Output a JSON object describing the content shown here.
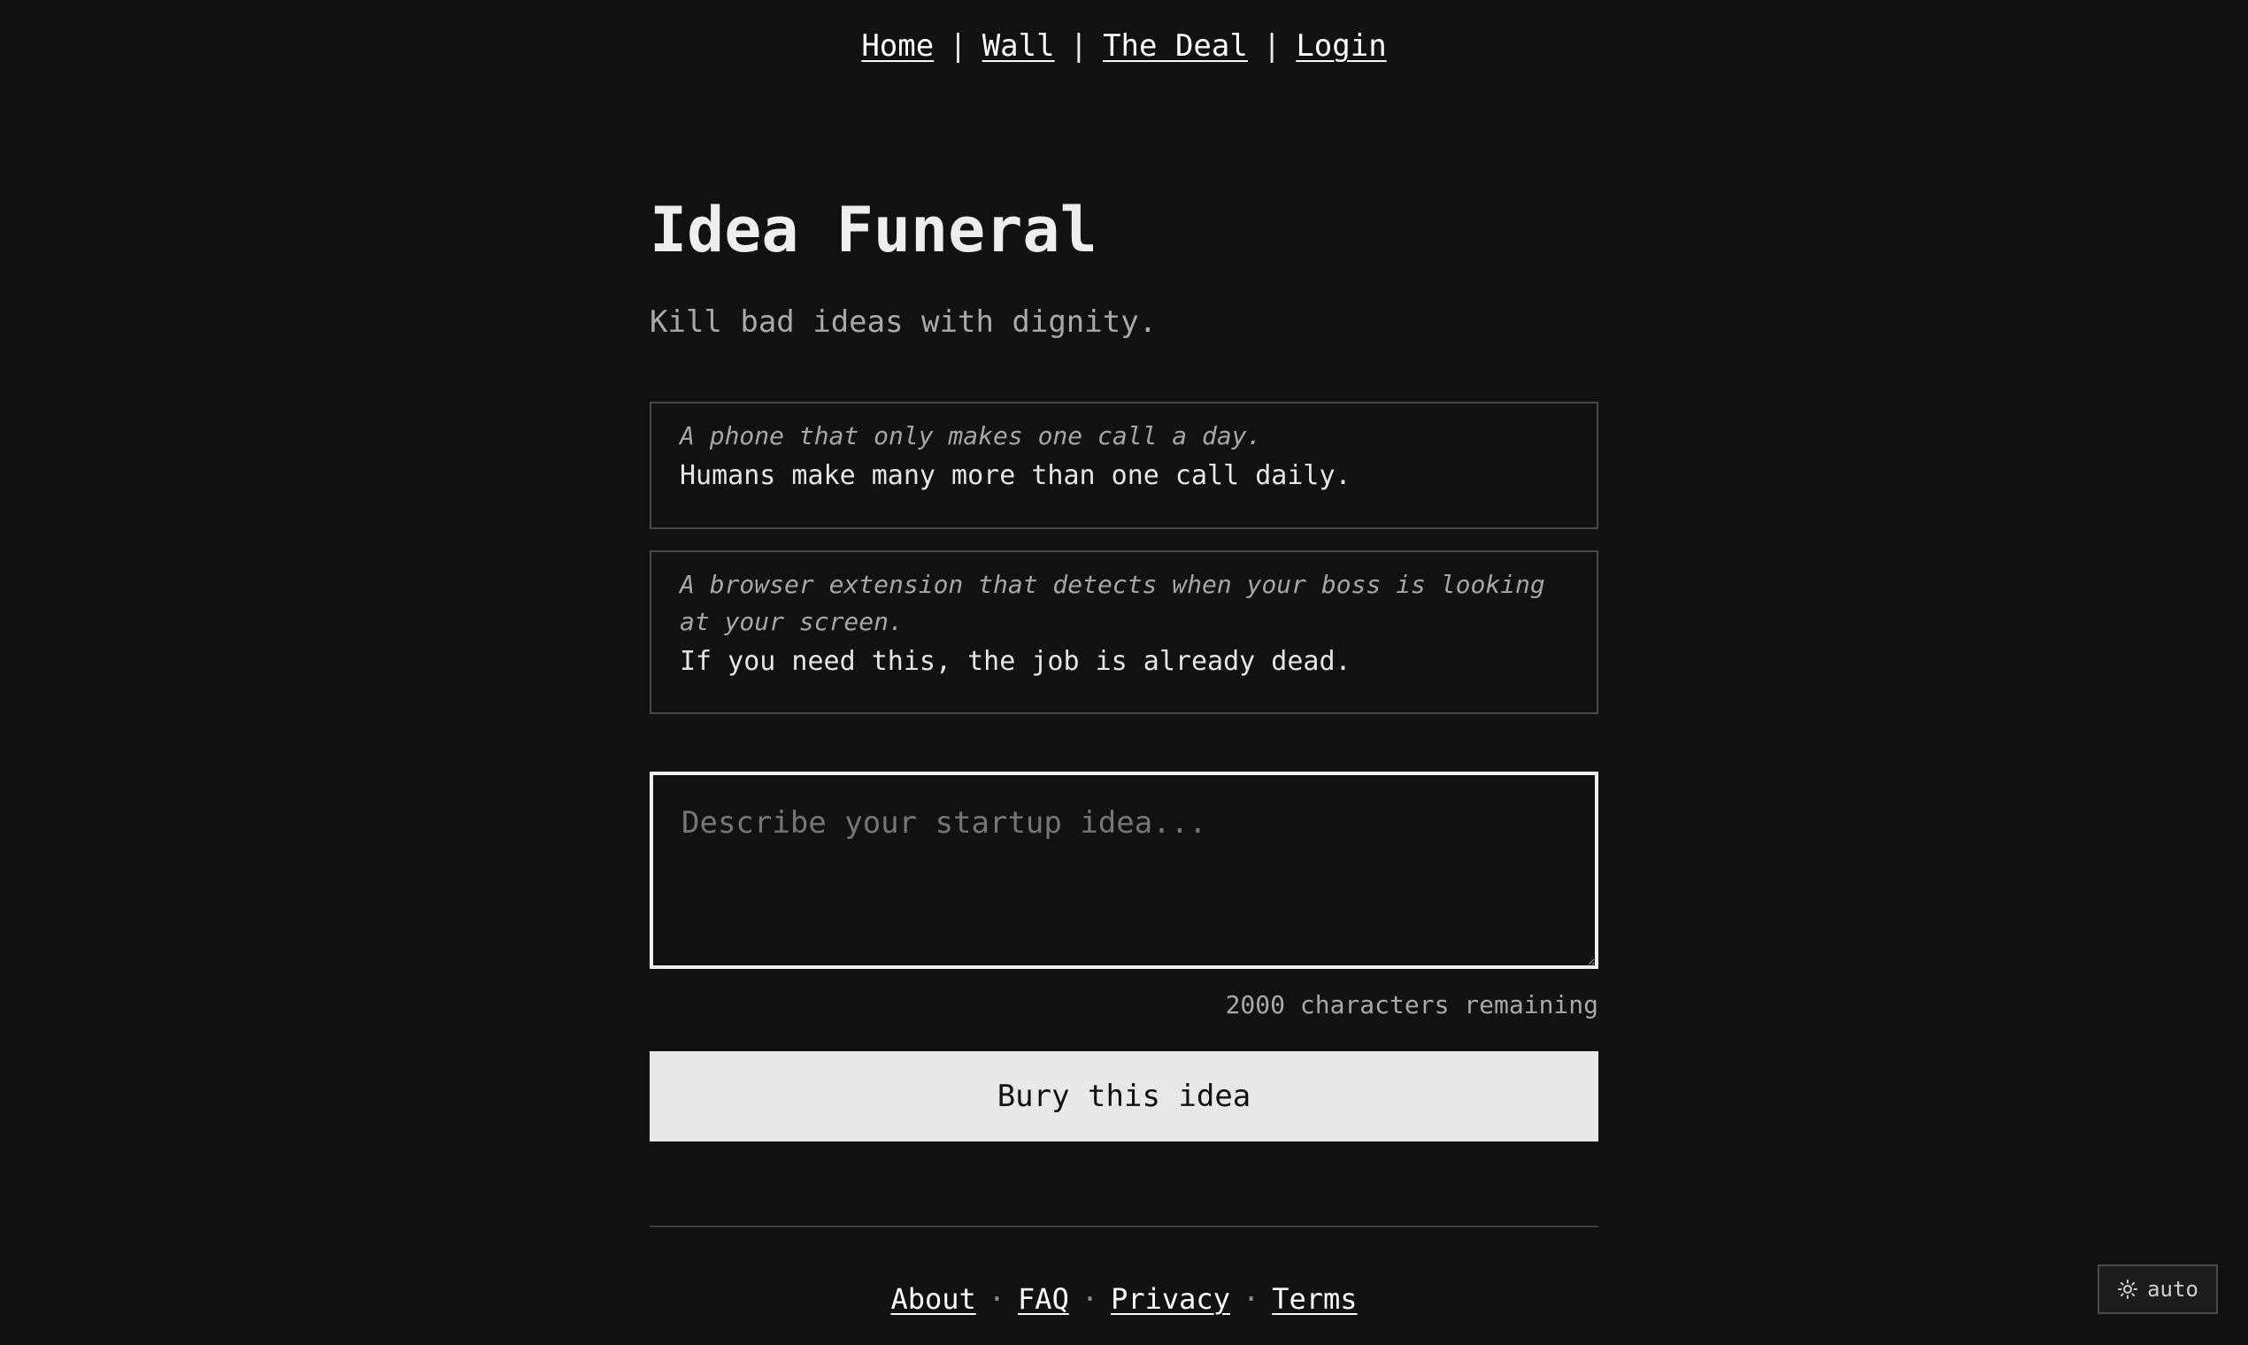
{
  "nav": {
    "items": [
      {
        "label": "Home"
      },
      {
        "label": "Wall"
      },
      {
        "label": "The Deal"
      },
      {
        "label": "Login"
      }
    ],
    "separator": "|"
  },
  "hero": {
    "title": "Idea Funeral",
    "tagline": "Kill bad ideas with dignity."
  },
  "examples": [
    {
      "idea": "A phone that only makes one call a day.",
      "verdict": "Humans make many more than one call daily."
    },
    {
      "idea": "A browser extension that detects when your boss is looking at your screen.",
      "verdict": "If you need this, the job is already dead."
    }
  ],
  "form": {
    "idea_value": "",
    "idea_placeholder": "Describe your startup idea...",
    "counter": "2000 characters remaining",
    "submit_label": "Bury this idea"
  },
  "footer": {
    "links": [
      {
        "label": "About"
      },
      {
        "label": "FAQ"
      },
      {
        "label": "Privacy"
      },
      {
        "label": "Terms"
      }
    ],
    "separator": "·"
  },
  "theme": {
    "label": "auto",
    "icon": "sun-icon"
  }
}
